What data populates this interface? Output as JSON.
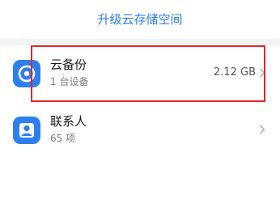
{
  "header": {
    "upgrade_label": "升级云存储空间"
  },
  "list": {
    "items": [
      {
        "title": "云备份",
        "subtitle": "1 台设备",
        "value": "2.12 GB",
        "icon": "cloud-backup-icon"
      },
      {
        "title": "联系人",
        "subtitle": "65 项",
        "value": "",
        "icon": "contacts-icon"
      }
    ]
  },
  "colors": {
    "accent": "#2a7de9",
    "icon_blue": "#2d7ff0",
    "highlight": "#e0282a"
  }
}
